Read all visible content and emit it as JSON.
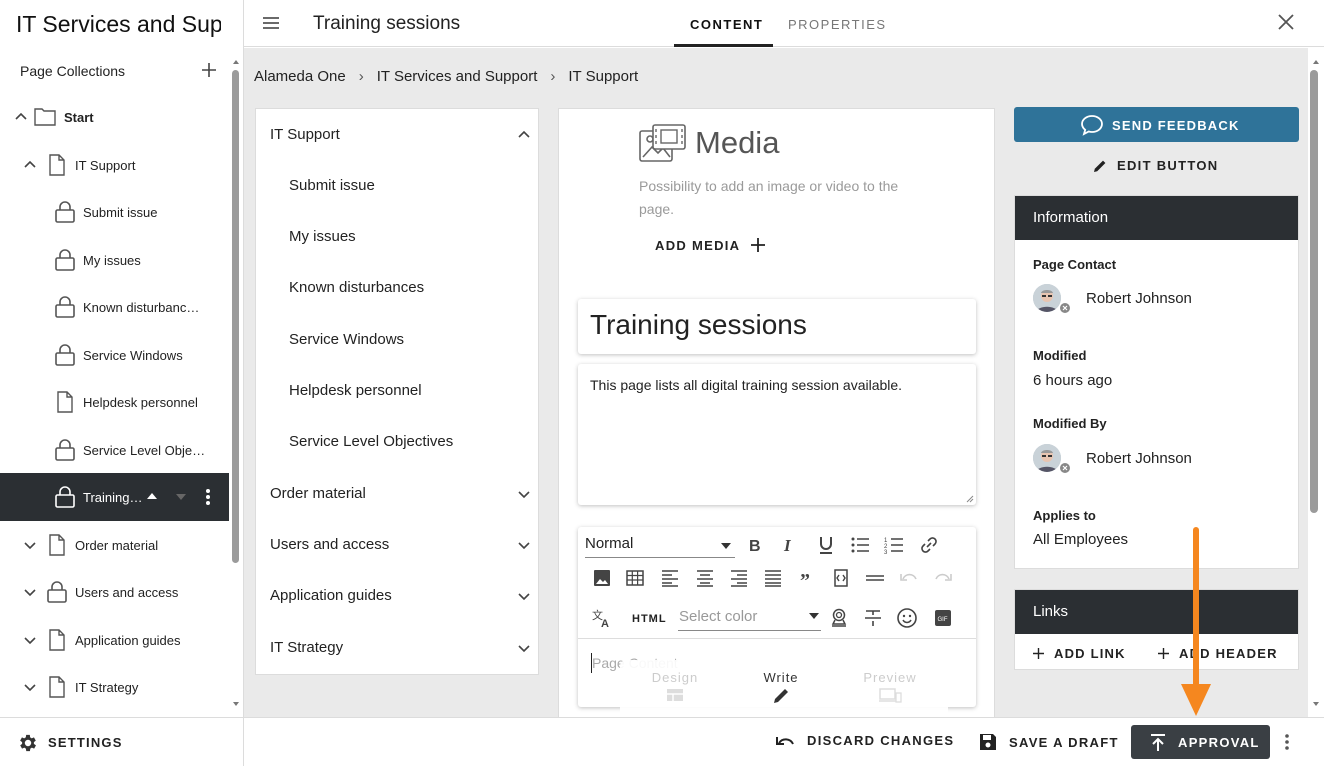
{
  "sidebar": {
    "site_title": "IT Services and Sup",
    "collections_label": "Page Collections",
    "tree": [
      {
        "label": "Start",
        "icon": "folder-icon",
        "chevron": "up"
      },
      {
        "label": "IT Support",
        "icon": "page-icon",
        "chevron": "up"
      },
      {
        "label": "Submit issue",
        "icon": "lock-icon"
      },
      {
        "label": "My issues",
        "icon": "lock-icon"
      },
      {
        "label": "Known disturbanc…",
        "icon": "lock-icon"
      },
      {
        "label": "Service Windows",
        "icon": "lock-icon"
      },
      {
        "label": "Helpdesk personnel",
        "icon": "page-icon"
      },
      {
        "label": "Service Level Obje…",
        "icon": "lock-icon"
      },
      {
        "label": "Training…",
        "icon": "lock-icon",
        "selected": true
      },
      {
        "label": "Order material",
        "icon": "page-icon",
        "chevron": "down"
      },
      {
        "label": "Users and access",
        "icon": "lock-icon",
        "chevron": "down"
      },
      {
        "label": "Application guides",
        "icon": "page-icon",
        "chevron": "down"
      },
      {
        "label": "IT Strategy",
        "icon": "page-icon",
        "chevron": "down"
      }
    ],
    "settings_label": "SETTINGS"
  },
  "topbar": {
    "page_heading": "Training sessions",
    "tabs": [
      "CONTENT",
      "PROPERTIES"
    ],
    "active_tab": "CONTENT"
  },
  "breadcrumb": [
    "Alameda One",
    "IT Services and Support",
    "IT Support"
  ],
  "nav_panel": {
    "items": [
      {
        "label": "IT Support",
        "level": 0,
        "chevron": "up"
      },
      {
        "label": "Submit issue",
        "level": 1
      },
      {
        "label": "My issues",
        "level": 1
      },
      {
        "label": "Known disturbances",
        "level": 1
      },
      {
        "label": "Service Windows",
        "level": 1
      },
      {
        "label": "Helpdesk personnel",
        "level": 1
      },
      {
        "label": "Service Level Objectives",
        "level": 1
      },
      {
        "label": "Order material",
        "level": 0,
        "chevron": "down"
      },
      {
        "label": "Users and access",
        "level": 0,
        "chevron": "down"
      },
      {
        "label": "Application guides",
        "level": 0,
        "chevron": "down"
      },
      {
        "label": "IT Strategy",
        "level": 0,
        "chevron": "down"
      }
    ]
  },
  "editor": {
    "media_title": "Media",
    "media_description": "Possibility to add an image or video to the page.",
    "add_media_label": "ADD MEDIA",
    "title_value": "Training sessions",
    "description_value": "This page lists all digital training session available.",
    "format_value": "Normal",
    "html_label": "HTML",
    "color_placeholder": "Select color",
    "content_placeholder": "Page Content",
    "modes": [
      "Design",
      "Write",
      "Preview"
    ],
    "active_mode": "Write"
  },
  "right_panel": {
    "feedback_label": "SEND FEEDBACK",
    "edit_label": "EDIT BUTTON",
    "info_title": "Information",
    "page_contact_label": "Page Contact",
    "page_contact_name": "Robert Johnson",
    "modified_label": "Modified",
    "modified_value": "6 hours ago",
    "modified_by_label": "Modified By",
    "modified_by_name": "Robert Johnson",
    "applies_to_label": "Applies to",
    "applies_to_value": "All Employees",
    "links_title": "Links",
    "add_link_label": "ADD LINK",
    "add_header_label": "ADD HEADER"
  },
  "bottombar": {
    "discard_label": "DISCARD CHANGES",
    "save_draft_label": "SAVE A DRAFT",
    "approval_label": "APPROVAL"
  },
  "colors": {
    "accent_blue": "#2f7399",
    "dark": "#2b2f33",
    "annotation_orange": "#f5871f"
  }
}
